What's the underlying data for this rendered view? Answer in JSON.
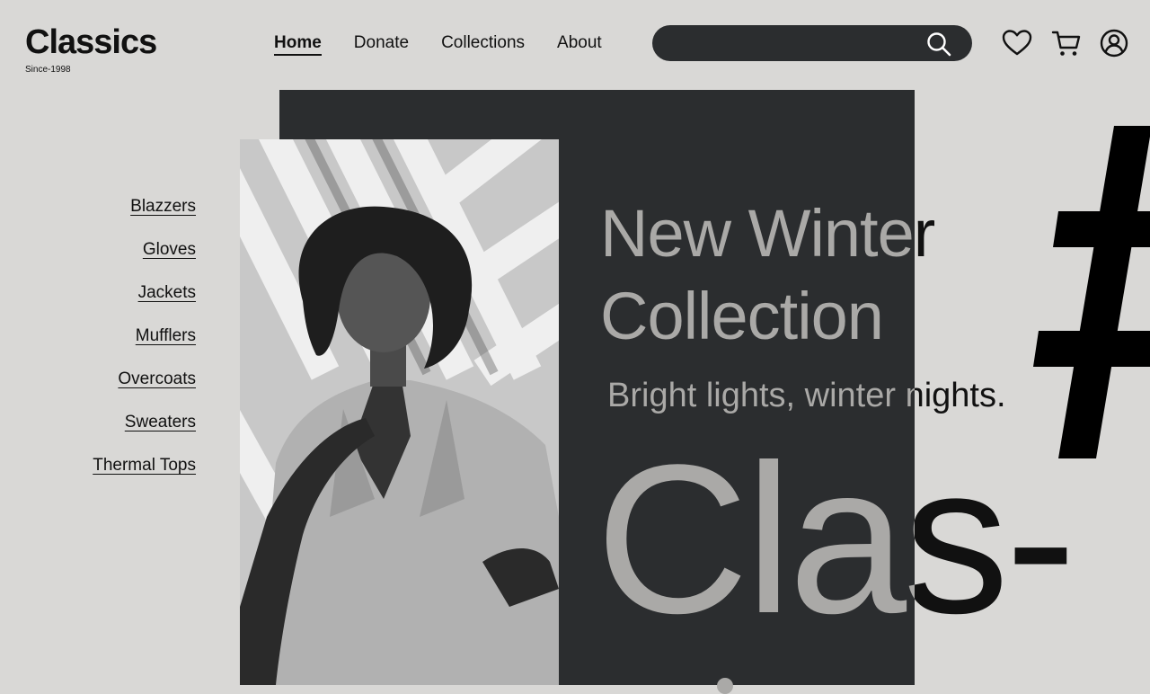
{
  "brand": {
    "name": "Classics",
    "tagline": "Since-1998"
  },
  "nav": {
    "home": "Home",
    "donate": "Donate",
    "collections": "Collections",
    "about": "About"
  },
  "search": {
    "value": "",
    "placeholder": ""
  },
  "header_icons": {
    "search": "search-icon",
    "wishlist": "heart-icon",
    "cart": "cart-icon",
    "account": "user-icon"
  },
  "categories": [
    {
      "label": "Blazzers"
    },
    {
      "label": "Gloves"
    },
    {
      "label": "Jackets"
    },
    {
      "label": "Mufflers"
    },
    {
      "label": "Overcoats"
    },
    {
      "label": "Sweaters"
    },
    {
      "label": "Thermal Tops"
    }
  ],
  "hero": {
    "headline_line1": "New Winter",
    "headline_line2": "Collection",
    "tagline": "Bright lights, winter nights.",
    "big_word": "Clas-",
    "symbol": "#"
  },
  "colors": {
    "background": "#d9d8d6",
    "panel": "#2b2d2f",
    "text_dark": "#111111",
    "text_muted": "#aaa9a7"
  }
}
